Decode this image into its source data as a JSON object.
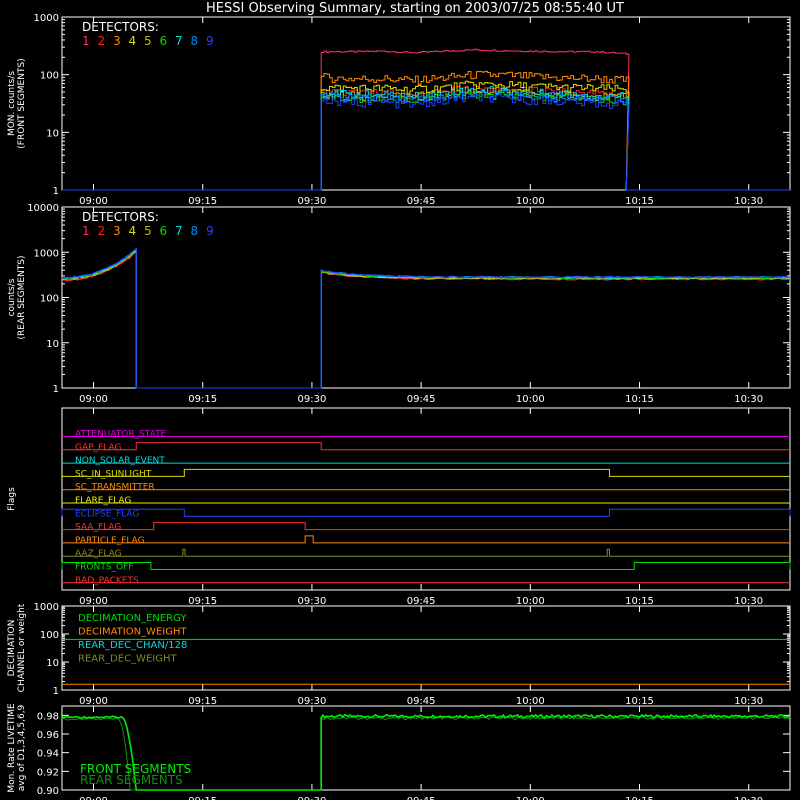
{
  "title": "HESSI Observing Summary, starting on 2003/07/25 08:55:40 UT",
  "colors": {
    "det": [
      "#ff3060",
      "#ff2020",
      "#ff8800",
      "#dddd00",
      "#bbbb00",
      "#00dd00",
      "#00dddd",
      "#0088ff",
      "#2040ff"
    ],
    "axis": "#ffffff",
    "background": "#000000"
  },
  "time_axis": {
    "range_minutes": [
      0,
      100
    ],
    "ticks": [
      {
        "m": 4.33,
        "label": "09:00"
      },
      {
        "m": 19.33,
        "label": "09:15"
      },
      {
        "m": 34.33,
        "label": "09:30"
      },
      {
        "m": 49.33,
        "label": "09:45"
      },
      {
        "m": 64.33,
        "label": "10:00"
      },
      {
        "m": 79.33,
        "label": "10:15"
      },
      {
        "m": 94.33,
        "label": "10:30"
      }
    ]
  },
  "chart_data": [
    {
      "id": "front",
      "type": "line",
      "ylabel": [
        "MON. counts/s",
        "(FRONT SEGMENTS)"
      ],
      "yscale": "log",
      "ylim": [
        1,
        1000
      ],
      "yticks": [
        {
          "v": 1,
          "label": "1"
        },
        {
          "v": 10,
          "label": "10"
        },
        {
          "v": 100,
          "label": "100"
        },
        {
          "v": 1000,
          "label": "1000"
        }
      ],
      "legend_title": "DETECTORS:",
      "legend_labels": [
        "1",
        "2",
        "3",
        "4",
        "5",
        "6",
        "7",
        "8",
        "9"
      ],
      "active_intervals": [
        [
          35.6,
          77.5
        ]
      ],
      "series": [
        {
          "name": "1",
          "values": [
            250,
            250,
            255,
            240,
            255,
            270,
            260,
            255,
            250,
            250,
            230
          ]
        },
        {
          "name": "2",
          "values": [
            50,
            48,
            48,
            45,
            50,
            58,
            55,
            52,
            50,
            48,
            45
          ]
        },
        {
          "name": "3",
          "values": [
            90,
            85,
            85,
            80,
            88,
            100,
            98,
            92,
            88,
            85,
            80
          ]
        },
        {
          "name": "4",
          "values": [
            60,
            58,
            58,
            55,
            60,
            68,
            66,
            62,
            60,
            58,
            55
          ]
        },
        {
          "name": "5",
          "values": [
            45,
            43,
            42,
            40,
            45,
            52,
            50,
            46,
            45,
            42,
            40
          ]
        },
        {
          "name": "6",
          "values": [
            40,
            38,
            38,
            35,
            40,
            46,
            44,
            42,
            40,
            38,
            35
          ]
        },
        {
          "name": "7",
          "values": [
            48,
            45,
            45,
            42,
            47,
            55,
            52,
            48,
            46,
            44,
            42
          ]
        },
        {
          "name": "8",
          "values": [
            42,
            40,
            40,
            38,
            42,
            48,
            46,
            43,
            42,
            40,
            38
          ]
        },
        {
          "name": "9",
          "values": [
            35,
            33,
            33,
            30,
            35,
            40,
            38,
            36,
            34,
            32,
            30
          ]
        }
      ]
    },
    {
      "id": "rear",
      "type": "line",
      "ylabel": [
        "counts/s",
        "(REAR SEGMENTS)"
      ],
      "yscale": "log",
      "ylim": [
        1,
        10000
      ],
      "yticks": [
        {
          "v": 1,
          "label": "1"
        },
        {
          "v": 10,
          "label": "10"
        },
        {
          "v": 100,
          "label": "100"
        },
        {
          "v": 1000,
          "label": "1000"
        },
        {
          "v": 10000,
          "label": "10000"
        }
      ],
      "legend_title": "DETECTORS:",
      "legend_labels": [
        "1",
        "2",
        "3",
        "4",
        "5",
        "6",
        "7",
        "8",
        "9"
      ],
      "intervals": [
        {
          "t": [
            0,
            10.2
          ],
          "start": 260,
          "end": 1100,
          "shape": "rise"
        },
        {
          "t": [
            35.6,
            100
          ],
          "start": 380,
          "end": 270,
          "shape": "decay"
        }
      ]
    },
    {
      "id": "flags",
      "type": "step",
      "ylabel": [
        "Flags"
      ],
      "flags": [
        {
          "name": "ATTENUATOR_STATE",
          "color": "#dd00dd",
          "highs": []
        },
        {
          "name": "GAP_FLAG",
          "color": "#ff3030",
          "highs": [
            [
              10.2,
              35.6
            ]
          ]
        },
        {
          "name": "NON_SOLAR_EVENT",
          "color": "#00dddd",
          "highs": []
        },
        {
          "name": "SC_IN_SUNLIGHT",
          "color": "#dddd00",
          "highs": [
            [
              16.8,
              75.2
            ]
          ]
        },
        {
          "name": "SC_TRANSMITTER",
          "color": "#ff8800",
          "highs": []
        },
        {
          "name": "FLARE_FLAG",
          "color": "#eeee00",
          "highs": []
        },
        {
          "name": "ECLIPSE_FLAG",
          "color": "#2040ff",
          "highs": [
            [
              0,
              16.8
            ],
            [
              75.2,
              100
            ]
          ]
        },
        {
          "name": "SAA_FLAG",
          "color": "#ff3030",
          "highs": [
            [
              12.6,
              33.4
            ]
          ]
        },
        {
          "name": "PARTICLE_FLAG",
          "color": "#ff8800",
          "highs": [
            [
              33.4,
              34.5
            ]
          ]
        },
        {
          "name": "AAZ_FLAG",
          "color": "#888820",
          "highs": [
            [
              16.6,
              16.9
            ],
            [
              74.9,
              75.2
            ]
          ]
        },
        {
          "name": "FRONTS_OFF",
          "color": "#00dd00",
          "highs": [
            [
              0,
              12.2
            ],
            [
              78.6,
              100
            ]
          ]
        },
        {
          "name": "BAD_PACKETS",
          "color": "#ff3030",
          "highs": []
        }
      ]
    },
    {
      "id": "decimation",
      "type": "line",
      "ylabel": [
        "DECIMATION",
        "CHANNEL or weight"
      ],
      "yscale": "log",
      "ylim": [
        1,
        1000
      ],
      "yticks": [
        {
          "v": 1,
          "label": "1"
        },
        {
          "v": 10,
          "label": "10"
        },
        {
          "v": 100,
          "label": "100"
        },
        {
          "v": 1000,
          "label": "1000"
        }
      ],
      "series": [
        {
          "name": "DECIMATION_ENERGY",
          "color": "#00dd00",
          "value": 64
        },
        {
          "name": "DECIMATION_WEIGHT",
          "color": "#ff8800",
          "value": 1.6
        },
        {
          "name": "REAR_DEC_CHAN/128",
          "color": "#00dddd",
          "value": null
        },
        {
          "name": "REAR_DEC_WEIGHT",
          "color": "#888820",
          "value": null
        }
      ]
    },
    {
      "id": "livetime",
      "type": "line",
      "ylabel": [
        "Mon. Rate LIVETIME",
        "avg of D1,3,4,5,6,9"
      ],
      "ylim": [
        0.9,
        0.99
      ],
      "yticks": [
        {
          "v": 0.9,
          "label": "0.90"
        },
        {
          "v": 0.92,
          "label": "0.92"
        },
        {
          "v": 0.94,
          "label": "0.94"
        },
        {
          "v": 0.96,
          "label": "0.96"
        },
        {
          "v": 0.98,
          "label": "0.98"
        }
      ],
      "series": [
        {
          "name": "FRONT SEGMENTS",
          "color": "#00ee00",
          "level": 0.979
        },
        {
          "name": "REAR SEGMENTS",
          "color": "#109010",
          "level": 0.977
        }
      ]
    }
  ]
}
